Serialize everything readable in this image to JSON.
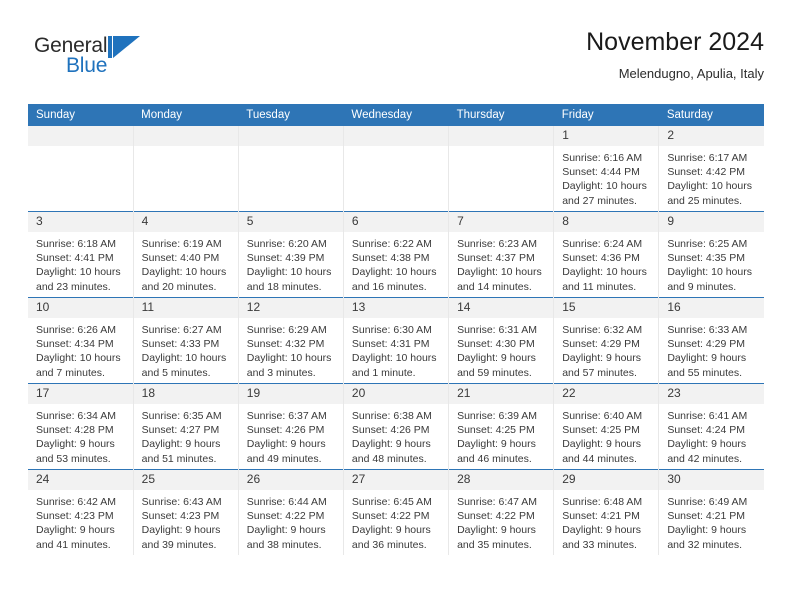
{
  "brand": {
    "name_part1": "General",
    "name_part2": "Blue",
    "mark": "triangle-logo",
    "accent_color": "#1f72bd"
  },
  "header": {
    "title": "November 2024",
    "subtitle": "Melendugno, Apulia, Italy"
  },
  "theme": {
    "header_bg": "#2e75b6",
    "daynum_bg": "#f2f2f2",
    "row_divider": "#2e75b6"
  },
  "calendar": {
    "weekday_headers": [
      "Sunday",
      "Monday",
      "Tuesday",
      "Wednesday",
      "Thursday",
      "Friday",
      "Saturday"
    ],
    "weeks": [
      [
        {
          "day": "",
          "lines": []
        },
        {
          "day": "",
          "lines": []
        },
        {
          "day": "",
          "lines": []
        },
        {
          "day": "",
          "lines": []
        },
        {
          "day": "",
          "lines": []
        },
        {
          "day": "1",
          "lines": [
            "Sunrise: 6:16 AM",
            "Sunset: 4:44 PM",
            "Daylight: 10 hours and 27 minutes."
          ]
        },
        {
          "day": "2",
          "lines": [
            "Sunrise: 6:17 AM",
            "Sunset: 4:42 PM",
            "Daylight: 10 hours and 25 minutes."
          ]
        }
      ],
      [
        {
          "day": "3",
          "lines": [
            "Sunrise: 6:18 AM",
            "Sunset: 4:41 PM",
            "Daylight: 10 hours and 23 minutes."
          ]
        },
        {
          "day": "4",
          "lines": [
            "Sunrise: 6:19 AM",
            "Sunset: 4:40 PM",
            "Daylight: 10 hours and 20 minutes."
          ]
        },
        {
          "day": "5",
          "lines": [
            "Sunrise: 6:20 AM",
            "Sunset: 4:39 PM",
            "Daylight: 10 hours and 18 minutes."
          ]
        },
        {
          "day": "6",
          "lines": [
            "Sunrise: 6:22 AM",
            "Sunset: 4:38 PM",
            "Daylight: 10 hours and 16 minutes."
          ]
        },
        {
          "day": "7",
          "lines": [
            "Sunrise: 6:23 AM",
            "Sunset: 4:37 PM",
            "Daylight: 10 hours and 14 minutes."
          ]
        },
        {
          "day": "8",
          "lines": [
            "Sunrise: 6:24 AM",
            "Sunset: 4:36 PM",
            "Daylight: 10 hours and 11 minutes."
          ]
        },
        {
          "day": "9",
          "lines": [
            "Sunrise: 6:25 AM",
            "Sunset: 4:35 PM",
            "Daylight: 10 hours and 9 minutes."
          ]
        }
      ],
      [
        {
          "day": "10",
          "lines": [
            "Sunrise: 6:26 AM",
            "Sunset: 4:34 PM",
            "Daylight: 10 hours and 7 minutes."
          ]
        },
        {
          "day": "11",
          "lines": [
            "Sunrise: 6:27 AM",
            "Sunset: 4:33 PM",
            "Daylight: 10 hours and 5 minutes."
          ]
        },
        {
          "day": "12",
          "lines": [
            "Sunrise: 6:29 AM",
            "Sunset: 4:32 PM",
            "Daylight: 10 hours and 3 minutes."
          ]
        },
        {
          "day": "13",
          "lines": [
            "Sunrise: 6:30 AM",
            "Sunset: 4:31 PM",
            "Daylight: 10 hours and 1 minute."
          ]
        },
        {
          "day": "14",
          "lines": [
            "Sunrise: 6:31 AM",
            "Sunset: 4:30 PM",
            "Daylight: 9 hours and 59 minutes."
          ]
        },
        {
          "day": "15",
          "lines": [
            "Sunrise: 6:32 AM",
            "Sunset: 4:29 PM",
            "Daylight: 9 hours and 57 minutes."
          ]
        },
        {
          "day": "16",
          "lines": [
            "Sunrise: 6:33 AM",
            "Sunset: 4:29 PM",
            "Daylight: 9 hours and 55 minutes."
          ]
        }
      ],
      [
        {
          "day": "17",
          "lines": [
            "Sunrise: 6:34 AM",
            "Sunset: 4:28 PM",
            "Daylight: 9 hours and 53 minutes."
          ]
        },
        {
          "day": "18",
          "lines": [
            "Sunrise: 6:35 AM",
            "Sunset: 4:27 PM",
            "Daylight: 9 hours and 51 minutes."
          ]
        },
        {
          "day": "19",
          "lines": [
            "Sunrise: 6:37 AM",
            "Sunset: 4:26 PM",
            "Daylight: 9 hours and 49 minutes."
          ]
        },
        {
          "day": "20",
          "lines": [
            "Sunrise: 6:38 AM",
            "Sunset: 4:26 PM",
            "Daylight: 9 hours and 48 minutes."
          ]
        },
        {
          "day": "21",
          "lines": [
            "Sunrise: 6:39 AM",
            "Sunset: 4:25 PM",
            "Daylight: 9 hours and 46 minutes."
          ]
        },
        {
          "day": "22",
          "lines": [
            "Sunrise: 6:40 AM",
            "Sunset: 4:25 PM",
            "Daylight: 9 hours and 44 minutes."
          ]
        },
        {
          "day": "23",
          "lines": [
            "Sunrise: 6:41 AM",
            "Sunset: 4:24 PM",
            "Daylight: 9 hours and 42 minutes."
          ]
        }
      ],
      [
        {
          "day": "24",
          "lines": [
            "Sunrise: 6:42 AM",
            "Sunset: 4:23 PM",
            "Daylight: 9 hours and 41 minutes."
          ]
        },
        {
          "day": "25",
          "lines": [
            "Sunrise: 6:43 AM",
            "Sunset: 4:23 PM",
            "Daylight: 9 hours and 39 minutes."
          ]
        },
        {
          "day": "26",
          "lines": [
            "Sunrise: 6:44 AM",
            "Sunset: 4:22 PM",
            "Daylight: 9 hours and 38 minutes."
          ]
        },
        {
          "day": "27",
          "lines": [
            "Sunrise: 6:45 AM",
            "Sunset: 4:22 PM",
            "Daylight: 9 hours and 36 minutes."
          ]
        },
        {
          "day": "28",
          "lines": [
            "Sunrise: 6:47 AM",
            "Sunset: 4:22 PM",
            "Daylight: 9 hours and 35 minutes."
          ]
        },
        {
          "day": "29",
          "lines": [
            "Sunrise: 6:48 AM",
            "Sunset: 4:21 PM",
            "Daylight: 9 hours and 33 minutes."
          ]
        },
        {
          "day": "30",
          "lines": [
            "Sunrise: 6:49 AM",
            "Sunset: 4:21 PM",
            "Daylight: 9 hours and 32 minutes."
          ]
        }
      ]
    ]
  }
}
